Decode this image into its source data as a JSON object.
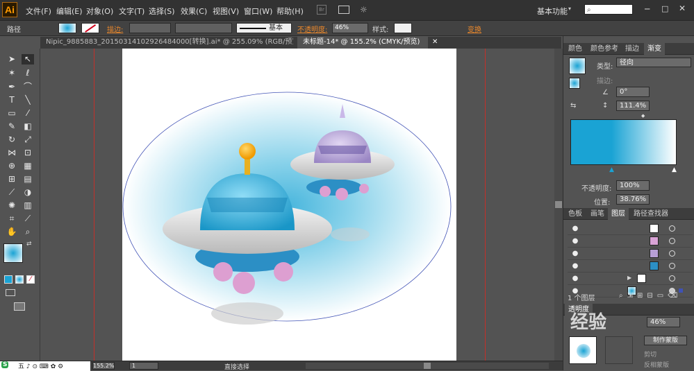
{
  "app": {
    "logo": "Ai",
    "workspace": "基本功能"
  },
  "menu": [
    "文件(F)",
    "编辑(E)",
    "对象(O)",
    "文字(T)",
    "选择(S)",
    "效果(C)",
    "视图(V)",
    "窗口(W)",
    "帮助(H)"
  ],
  "control": {
    "label": "路径",
    "stroke": "描边:",
    "stroke_style": "基本",
    "opacity_label": "不透明度:",
    "opacity": "46%",
    "style_label": "样式:",
    "transform": "变换"
  },
  "tabs": [
    {
      "label": "Nipic_9885883_20150314102926484000[转换].ai* @ 255.09% (RGB/预览)",
      "active": false
    },
    {
      "label": "未标题-14* @ 155.2% (CMYK/预览)",
      "active": true
    }
  ],
  "status": {
    "zoom": "155.2%",
    "page": "1",
    "tool": "直接选择"
  },
  "gradient_panel": {
    "tabs": [
      "颜色",
      "颜色参考",
      "描边",
      "渐变"
    ],
    "type_label": "类型:",
    "type": "径向",
    "stroke_label": "描边:",
    "angle": "0°",
    "aspect": "111.4%",
    "opacity_label": "不透明度:",
    "opacity": "100%",
    "location_label": "位置:",
    "location": "38.76%",
    "start_color": "#1aa3d4",
    "end_color": "#ffffff"
  },
  "layers_panel": {
    "tabs": [
      "色板",
      "画笔",
      "图层",
      "路径查找器"
    ],
    "layer_count": "1 个图层",
    "rows": [
      {
        "visible": true
      },
      {
        "visible": true
      },
      {
        "visible": true
      },
      {
        "visible": true
      },
      {
        "visible": true
      },
      {
        "visible": true
      }
    ]
  },
  "bottom_panel": {
    "tab": "透明度",
    "opacity": "46%",
    "make_mask": "制作蒙版",
    "clip": "剪切",
    "invert": "反相蒙版"
  },
  "watermark": "经验"
}
